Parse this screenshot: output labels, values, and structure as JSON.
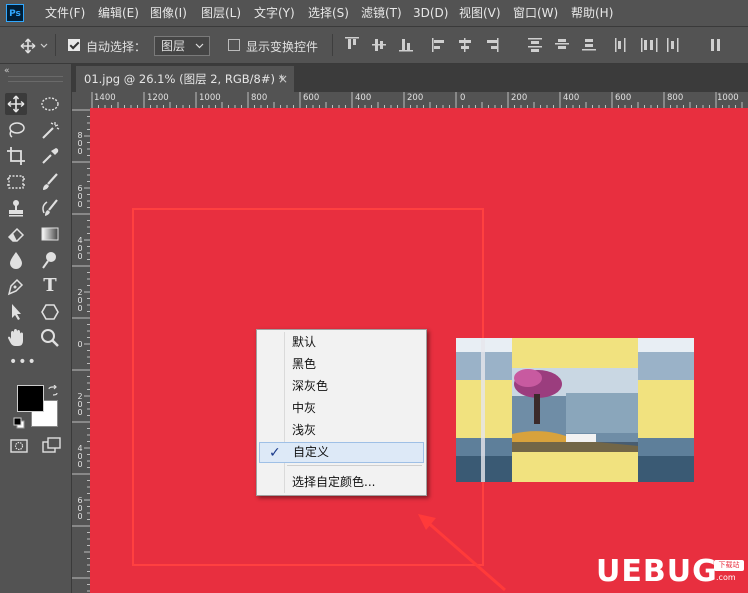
{
  "app": {
    "logo_text": "Ps"
  },
  "menubar": {
    "items": [
      "文件(F)",
      "编辑(E)",
      "图像(I)",
      "图层(L)",
      "文字(Y)",
      "选择(S)",
      "滤镜(T)",
      "3D(D)",
      "视图(V)",
      "窗口(W)",
      "帮助(H)"
    ]
  },
  "options": {
    "auto_select_label": "自动选择：",
    "auto_select_checked": true,
    "target_value": "图层",
    "show_transform_label": "显示变换控件",
    "show_transform_checked": false
  },
  "document": {
    "tab_title": "01.jpg @ 26.1% (图层 2, RGB/8#) *",
    "close_glyph": "×",
    "canvas_color": "#e82f3f"
  },
  "rulers": {
    "top_labels": [
      "1400",
      "1200",
      "1000",
      "800",
      "600",
      "400",
      "200",
      "0",
      "200",
      "400",
      "600",
      "800",
      "1000"
    ],
    "left_labels": [
      "8\n0\n0",
      "6\n0\n0",
      "4\n0\n0",
      "2\n0\n0",
      "0",
      "2\n0\n0",
      "4\n0\n0",
      "6\n0\n0"
    ]
  },
  "context_menu": {
    "items": [
      {
        "label": "默认",
        "selected": false
      },
      {
        "label": "黑色",
        "selected": false
      },
      {
        "label": "深灰色",
        "selected": false
      },
      {
        "label": "中灰",
        "selected": false
      },
      {
        "label": "浅灰",
        "selected": false
      },
      {
        "label": "自定义",
        "selected": true
      },
      {
        "label": "选择自定颜色...",
        "selected": false
      }
    ],
    "check_glyph": "✓"
  },
  "colors": {
    "foreground": "#000000",
    "background": "#ffffff",
    "panel": "#535353",
    "accent_canvas": "#e82f3f",
    "menu_highlight": "#dde9f7"
  },
  "tools": [
    "move-icon",
    "marquee-ellipse-icon",
    "lasso-icon",
    "magic-wand-icon",
    "crop-icon",
    "eyedropper-icon",
    "frame-icon",
    "brush-icon",
    "stamp-icon",
    "history-brush-icon",
    "eraser-icon",
    "gradient-icon",
    "blur-drop-icon",
    "dodge-icon",
    "pen-icon",
    "type-icon",
    "path-select-icon",
    "shape-icon",
    "hand-icon",
    "zoom-icon"
  ],
  "watermark": {
    "text": "UEBUG",
    "badge": "下载站",
    "url": ".com"
  }
}
